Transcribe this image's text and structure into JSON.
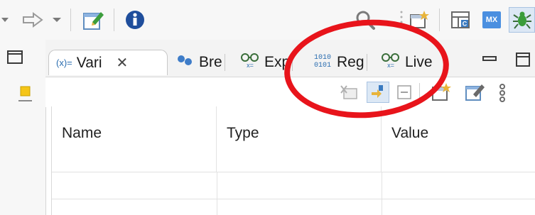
{
  "toolbar": {
    "icons": [
      "dropdown-arrow-icon",
      "forward-arrow-icon",
      "dropdown-arrow-icon",
      "edit-icon",
      "info-icon",
      "search-icon",
      "perspective-icon",
      "class-icon",
      "mx-icon",
      "debug-perspective-icon"
    ],
    "mx_label": "MX"
  },
  "tabs": [
    {
      "id": "variables",
      "label": "Vari",
      "prefix": "(x)=",
      "active": true,
      "close": "✕"
    },
    {
      "id": "breakpoints",
      "label": "Bre",
      "active": false
    },
    {
      "id": "expressions",
      "label": "Exp",
      "active": false
    },
    {
      "id": "registers",
      "label": "Reg",
      "prefix": "1010\n0101",
      "active": false
    },
    {
      "id": "live",
      "label": "Live",
      "active": false
    }
  ],
  "table": {
    "columns": [
      "Name",
      "Type",
      "Value"
    ]
  },
  "colors": {
    "accent_red": "#e8141b",
    "info_blue": "#1f4e9c"
  }
}
